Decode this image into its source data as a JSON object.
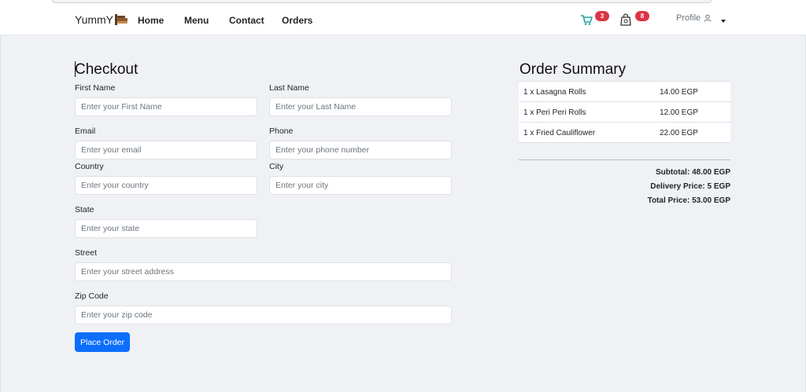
{
  "nav": {
    "brand": "YummY",
    "links": [
      "Home",
      "Menu",
      "Contact",
      "Orders"
    ],
    "cart_count": "3",
    "orders_count": "8",
    "profile_label": "Profile"
  },
  "checkout": {
    "title": "Checkout",
    "fields": {
      "first_name": {
        "label": "First Name",
        "placeholder": "Enter your First Name"
      },
      "last_name": {
        "label": "Last Name",
        "placeholder": "Enter your Last Name"
      },
      "email": {
        "label": "Email",
        "placeholder": "Enter your email"
      },
      "phone": {
        "label": "Phone",
        "placeholder": "Enter your phone number"
      },
      "country": {
        "label": "Country",
        "placeholder": "Enter your country"
      },
      "city": {
        "label": "City",
        "placeholder": "Enter your city"
      },
      "state": {
        "label": "State",
        "placeholder": "Enter your state"
      },
      "street": {
        "label": "Street",
        "placeholder": "Enter your street address"
      },
      "zip": {
        "label": "Zip Code",
        "placeholder": "Enter your zip code"
      }
    },
    "submit_label": "Place Order"
  },
  "summary": {
    "title": "Order Summary",
    "items": [
      {
        "name": "1 x Lasagna Rolls",
        "price": "14.00 EGP"
      },
      {
        "name": "1 x Peri Peri Rolls",
        "price": "12.00 EGP"
      },
      {
        "name": "1 x Fried Cauliflower",
        "price": "22.00 EGP"
      }
    ],
    "subtotal": "Subtotal: 48.00 EGP",
    "delivery": "Delivery Price: 5 EGP",
    "total": "Total Price: 53.00 EGP"
  },
  "colors": {
    "accent": "#0d6efd",
    "badge": "#dc3545",
    "background": "#eff1f5",
    "cart_icon": "#20a39e"
  }
}
